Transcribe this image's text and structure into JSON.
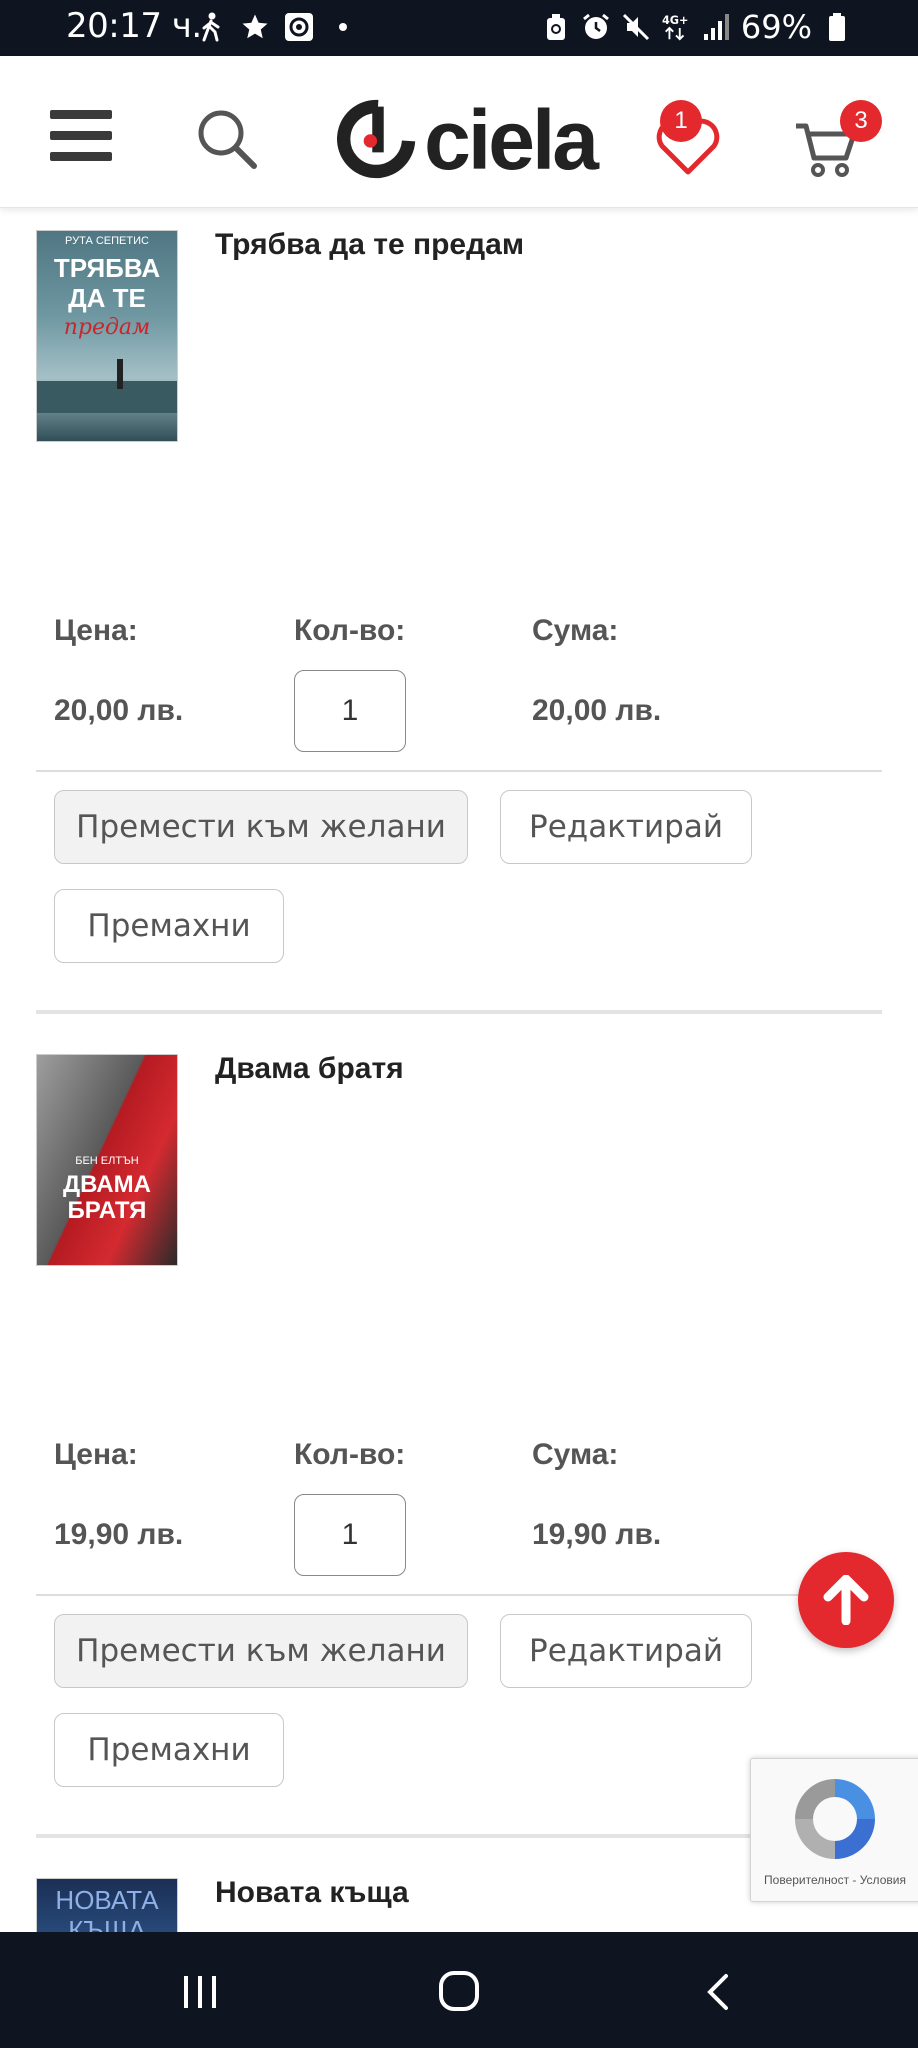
{
  "status_bar": {
    "time": "20:17 ч.",
    "battery": "69%"
  },
  "header": {
    "logo_text": "ciela",
    "wishlist_count": "1",
    "cart_count": "3"
  },
  "labels": {
    "price": "Цена:",
    "quantity": "Кол-во:",
    "sum": "Сума:"
  },
  "buttons": {
    "move_to_wishlist": "Премести към желани",
    "edit": "Редактирай",
    "remove": "Премахни"
  },
  "items": [
    {
      "title": "Трябва да те предам",
      "price": "20,00 лв.",
      "quantity": "1",
      "sum": "20,00 лв.",
      "cover": {
        "author": "РУТА СЕПЕТИС",
        "line1": "ТРЯБВА",
        "line2": "ДА ТЕ",
        "line3": "предам"
      }
    },
    {
      "title": "Двама братя",
      "price": "19,90 лв.",
      "quantity": "1",
      "sum": "19,90 лв.",
      "cover": {
        "author": "БЕН ЕЛТЪН",
        "line1": "ДВАМА",
        "line2": "БРАТЯ"
      }
    },
    {
      "title": "Новата къща",
      "cover": {
        "line1": "НОВАТА",
        "line2": "КЪЩА"
      }
    }
  ],
  "recaptcha": {
    "text": "Поверителност - Условия"
  },
  "colors": {
    "accent": "#e3282e",
    "system_bar": "#0f1520"
  }
}
